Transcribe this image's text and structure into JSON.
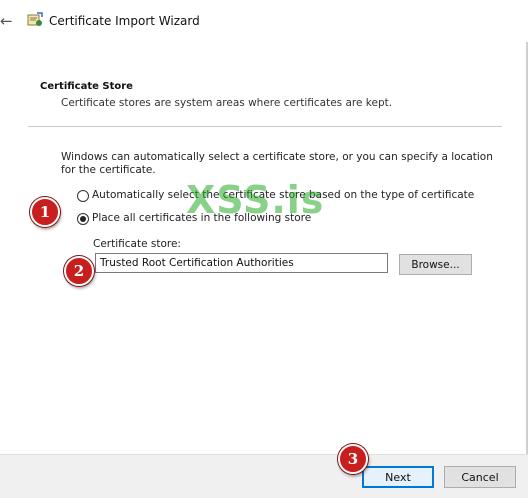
{
  "window": {
    "title": "Certificate Import Wizard",
    "back_icon": "back-arrow-icon",
    "app_icon": "certificate-wizard-icon"
  },
  "section": {
    "header": "Certificate Store",
    "description": "Certificate stores are system areas where certificates are kept."
  },
  "explanation": "Windows can automatically select a certificate store, or you can specify a location for the certificate.",
  "options": [
    {
      "label": "Automatically select the certificate store based on the type of certificate",
      "selected": false
    },
    {
      "label": "Place all certificates in the following store",
      "selected": true
    }
  ],
  "store": {
    "label": "Certificate store:",
    "value": "Trusted Root Certification Authorities",
    "browse_label": "Browse..."
  },
  "footer": {
    "next_label": "Next",
    "cancel_label": "Cancel"
  },
  "annotations": [
    "1",
    "2",
    "3"
  ],
  "watermark": "XSS.is",
  "colors": {
    "accent": "#0078d7",
    "badge": "#c81e1e",
    "watermark": "#28aa28"
  }
}
